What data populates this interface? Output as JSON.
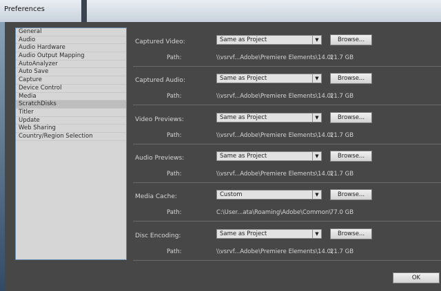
{
  "window": {
    "title": "Preferences"
  },
  "categories": [
    "General",
    "Audio",
    "Audio Hardware",
    "Audio Output Mapping",
    "AutoAnalyzer",
    "Auto Save",
    "Capture",
    "Device Control",
    "Media",
    "ScratchDisks",
    "Titler",
    "Update",
    "Web Sharing",
    "Country/Region Selection"
  ],
  "selected_category": "ScratchDisks",
  "settings": [
    {
      "label": "Captured Video:",
      "value": "Same as Project",
      "path_label": "Path:",
      "path": "\\\\vsrvf...Adobe\\Premiere Elements\\14.0\\",
      "size": "21.7 GB",
      "browse": "Browse..."
    },
    {
      "label": "Captured Audio:",
      "value": "Same as Project",
      "path_label": "Path:",
      "path": "\\\\vsrvf...Adobe\\Premiere Elements\\14.0\\",
      "size": "21.7 GB",
      "browse": "Browse..."
    },
    {
      "label": "Video Previews:",
      "value": "Same as Project",
      "path_label": "Path:",
      "path": "\\\\vsrvf...Adobe\\Premiere Elements\\14.0\\",
      "size": "21.7 GB",
      "browse": "Browse..."
    },
    {
      "label": "Audio Previews:",
      "value": "Same as Project",
      "path_label": "Path:",
      "path": "\\\\vsrvf...Adobe\\Premiere Elements\\14.0\\",
      "size": "21.7 GB",
      "browse": "Browse..."
    },
    {
      "label": "Media Cache:",
      "value": "Custom",
      "path_label": "Path:",
      "path": "C:\\User...ata\\Roaming\\Adobe\\Common\\",
      "size": "77.0 GB",
      "browse": "Browse..."
    },
    {
      "label": "Disc Encoding:",
      "value": "Same as Project",
      "path_label": "Path:",
      "path": "\\\\vsrvf...Adobe\\Premiere Elements\\14.0\\",
      "size": "21.7 GB",
      "browse": "Browse..."
    }
  ],
  "buttons": {
    "ok": "OK"
  },
  "icons": {
    "dropdown": "chevron-down-icon"
  }
}
